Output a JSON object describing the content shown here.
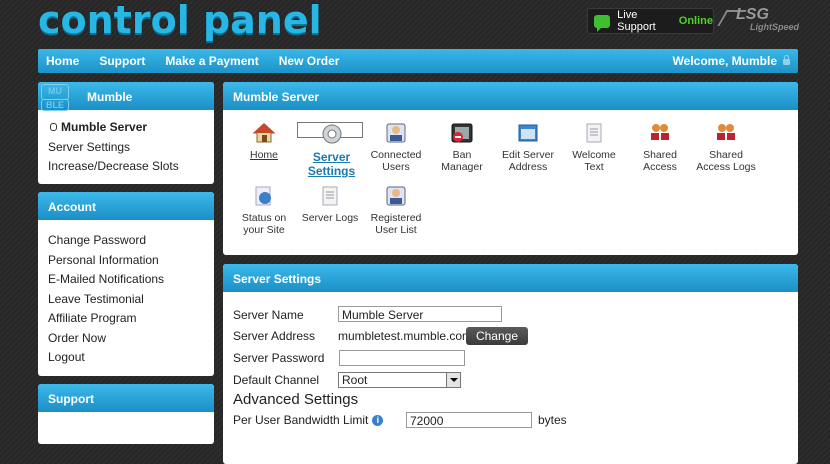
{
  "logo": "control panel",
  "live_support": {
    "label": "Live Support",
    "status": "Online"
  },
  "brand": {
    "line1": "LSG",
    "line2": "LightSpeed"
  },
  "nav": {
    "items": [
      "Home",
      "Support",
      "Make a Payment",
      "New Order"
    ],
    "welcome": "Welcome, Mumble"
  },
  "sidebar1": {
    "badge": [
      "BLE",
      "MU"
    ],
    "title": "Mumble",
    "items": [
      "Mumble Server",
      "Server Settings",
      "Increase/Decrease Slots"
    ]
  },
  "sidebar2": {
    "title": "Account",
    "items": [
      "Change Password",
      "Personal Information",
      "E-Mailed Notifications",
      "Leave Testimonial",
      "Affiliate Program",
      "Order Now",
      "Logout"
    ]
  },
  "sidebar3": {
    "title": "Support"
  },
  "main1": {
    "title": "Mumble Server",
    "icons": [
      {
        "line1": "Home",
        "line2": ""
      },
      {
        "line1": "Server",
        "line2": "Settings"
      },
      {
        "line1": "Connected",
        "line2": "Users"
      },
      {
        "line1": "Ban",
        "line2": "Manager"
      },
      {
        "line1": "Edit Server",
        "line2": "Address"
      },
      {
        "line1": "Welcome",
        "line2": "Text"
      },
      {
        "line1": "Shared",
        "line2": "Access"
      },
      {
        "line1": "Shared",
        "line2": "Access Logs"
      },
      {
        "line1": "Status on",
        "line2": "your Site"
      },
      {
        "line1": "Server Logs",
        "line2": ""
      },
      {
        "line1": "Registered",
        "line2": "User List"
      }
    ]
  },
  "main2": {
    "title": "Server Settings",
    "server_name_label": "Server Name",
    "server_name_value": "Mumble Server",
    "server_address_label": "Server Address",
    "server_address_value": "mumbletest.mumble.com",
    "change_button": "Change",
    "server_password_label": "Server Password",
    "server_password_value": "",
    "default_channel_label": "Default Channel",
    "default_channel_value": "Root",
    "advanced_title": "Advanced Settings",
    "bandwidth_label": "Per User Bandwidth Limit",
    "bandwidth_value": "72000",
    "bandwidth_unit": "bytes"
  },
  "colors": {
    "accent": "#2aa6dd",
    "live_online": "#4fd22f",
    "logo": "#28b6e4"
  }
}
